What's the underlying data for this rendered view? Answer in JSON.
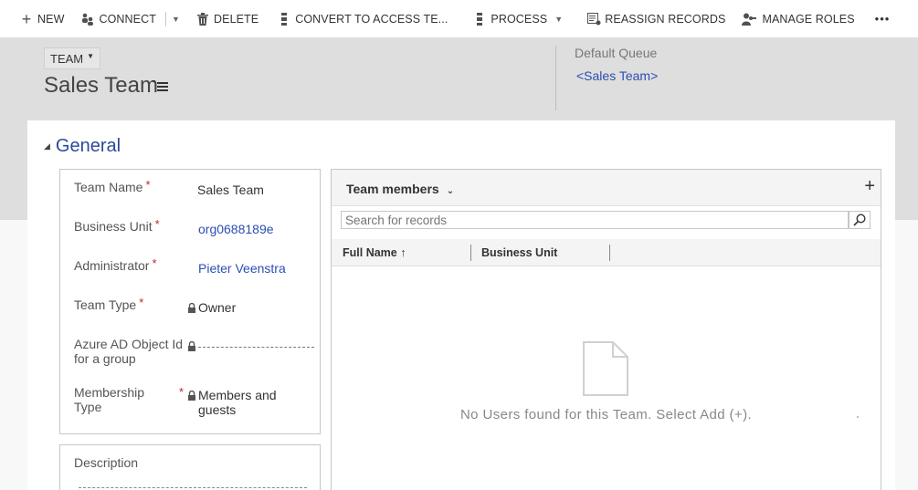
{
  "command_bar": {
    "new": "NEW",
    "connect": "CONNECT",
    "delete": "DELETE",
    "convert": "CONVERT TO ACCESS TE...",
    "process": "PROCESS",
    "reassign": "REASSIGN RECORDS",
    "manage_roles": "MANAGE ROLES",
    "more": "•••"
  },
  "header": {
    "entity": "TEAM",
    "title": "Sales Team",
    "default_queue_label": "Default Queue",
    "default_queue_value": "<Sales Team>"
  },
  "section": {
    "title": "General"
  },
  "fields": {
    "team_name_label": "Team Name",
    "team_name_value": "Sales Team",
    "business_unit_label": "Business Unit",
    "business_unit_value": "org0688189e",
    "administrator_label": "Administrator",
    "administrator_value": "Pieter Veenstra",
    "team_type_label": "Team Type",
    "team_type_value": "Owner",
    "azure_label_1": "Azure AD Object Id",
    "azure_label_2": "for a group",
    "membership_label_1": "Membership",
    "membership_label_2": "Type",
    "membership_value_1": "Members and",
    "membership_value_2": "guests",
    "required_mark": "*"
  },
  "description": {
    "label": "Description"
  },
  "subgrid": {
    "title": "Team members",
    "add": "+",
    "search_placeholder": "Search for records",
    "columns": [
      "Full Name",
      "Business Unit"
    ],
    "sort_arrow": "↑",
    "empty_message": "No Users found for this Team. Select Add (+)."
  }
}
